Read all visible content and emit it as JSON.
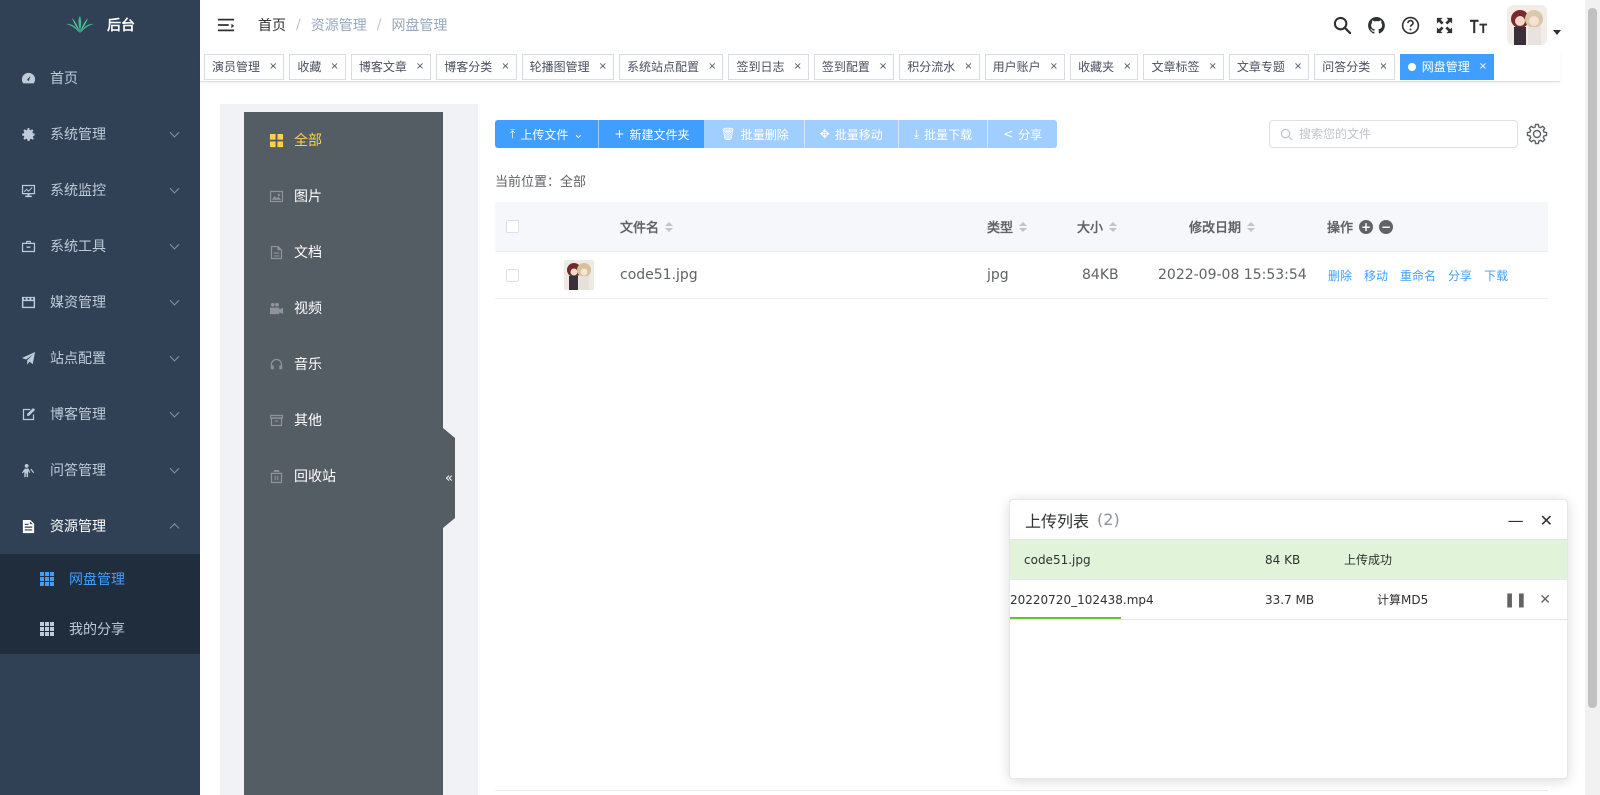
{
  "app": {
    "logo_text": "后台"
  },
  "sidebar": {
    "items": [
      {
        "label": "首页",
        "icon": "dashboard-icon"
      },
      {
        "label": "系统管理",
        "icon": "gear-icon"
      },
      {
        "label": "系统监控",
        "icon": "monitor-icon"
      },
      {
        "label": "系统工具",
        "icon": "toolbox-icon"
      },
      {
        "label": "媒资管理",
        "icon": "clapper-icon"
      },
      {
        "label": "站点配置",
        "icon": "paper-plane-icon"
      },
      {
        "label": "博客管理",
        "icon": "edit-icon"
      },
      {
        "label": "问答管理",
        "icon": "question-person-icon"
      },
      {
        "label": "资源管理",
        "icon": "document-icon"
      }
    ],
    "sub_items": [
      {
        "label": "网盘管理",
        "icon": "grid-icon"
      },
      {
        "label": "我的分享",
        "icon": "grid-icon"
      }
    ]
  },
  "breadcrumb": {
    "home": "首页",
    "level1": "资源管理",
    "level2": "网盘管理",
    "separator": "/"
  },
  "tags": [
    {
      "label": "演员管理"
    },
    {
      "label": "收藏"
    },
    {
      "label": "博客文章"
    },
    {
      "label": "博客分类"
    },
    {
      "label": "轮播图管理"
    },
    {
      "label": "系统站点配置"
    },
    {
      "label": "签到日志"
    },
    {
      "label": "签到配置"
    },
    {
      "label": "积分流水"
    },
    {
      "label": "用户账户"
    },
    {
      "label": "收藏夹"
    },
    {
      "label": "文章标签"
    },
    {
      "label": "文章专题"
    },
    {
      "label": "问答分类"
    },
    {
      "label": "网盘管理"
    }
  ],
  "tag_close": "×",
  "file_nav": {
    "items": [
      {
        "label": "全部"
      },
      {
        "label": "图片"
      },
      {
        "label": "文档"
      },
      {
        "label": "视频"
      },
      {
        "label": "音乐"
      },
      {
        "label": "其他"
      },
      {
        "label": "回收站"
      }
    ],
    "collapse": "«"
  },
  "toolbar": {
    "upload": "上传文件",
    "new_folder": "新建文件夹",
    "batch_delete": "批量删除",
    "batch_move": "批量移动",
    "batch_download": "批量下载",
    "share": "分享"
  },
  "search": {
    "placeholder": "搜索您的文件"
  },
  "location": {
    "label": "当前位置：",
    "value": "全部"
  },
  "table": {
    "headers": {
      "name": "文件名",
      "type": "类型",
      "size": "大小",
      "date": "修改日期",
      "ops": "操作"
    },
    "rows": [
      {
        "name": "code51.jpg",
        "type": "jpg",
        "size": "84KB",
        "date": "2022-09-08 15:53:54",
        "ops": [
          "删除",
          "移动",
          "重命名",
          "分享",
          "下载"
        ]
      }
    ]
  },
  "upload_panel": {
    "title": "上传列表",
    "count": "(2)",
    "items": [
      {
        "name": "code51.jpg",
        "size": "84 KB",
        "status": "上传成功",
        "progress": 1.0
      },
      {
        "name": "20220720_102438.mp4",
        "size": "33.7 MB",
        "status": "计算MD5",
        "progress": 0.2
      }
    ]
  },
  "colors": {
    "sidebar_bg": "#304156",
    "primary": "#409eff",
    "file_nav_bg": "#545c64",
    "active_nav": "#ffd04b",
    "success_bg": "#e1f3d8"
  }
}
